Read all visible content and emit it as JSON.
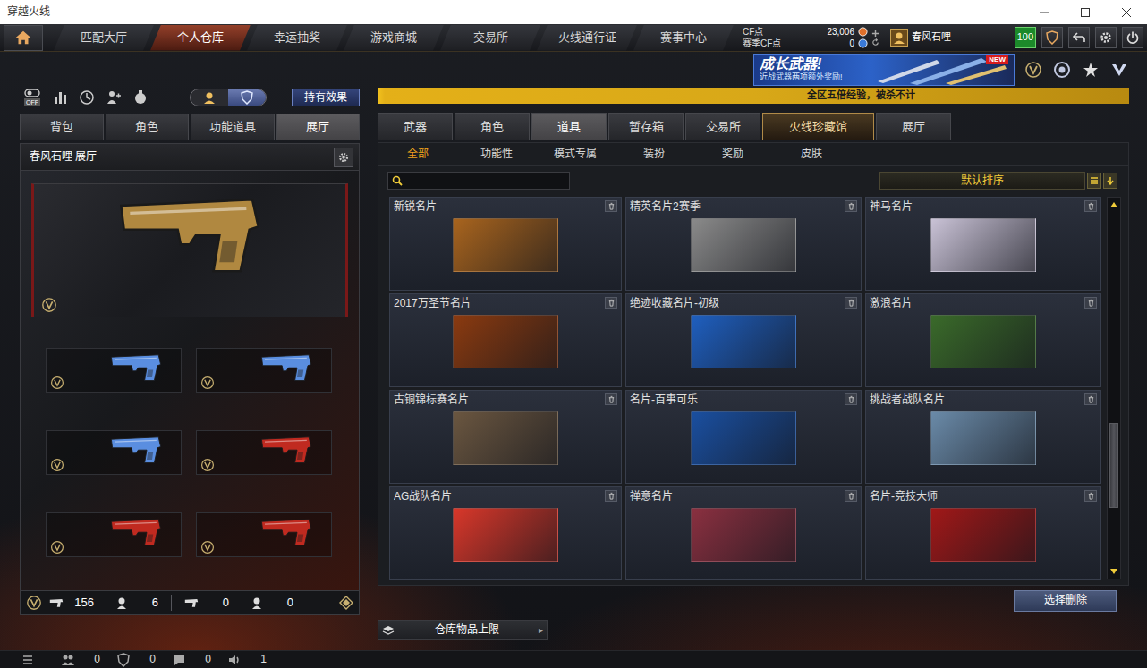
{
  "window": {
    "title": "穿越火线"
  },
  "nav": {
    "tabs": [
      {
        "label": "匹配大厅",
        "selected": false
      },
      {
        "label": "个人仓库",
        "selected": true
      },
      {
        "label": "幸运抽奖",
        "selected": false
      },
      {
        "label": "游戏商城",
        "selected": false
      },
      {
        "label": "交易所",
        "selected": false
      },
      {
        "label": "火线通行证",
        "selected": false
      },
      {
        "label": "赛事中心",
        "selected": false
      }
    ]
  },
  "currency": [
    {
      "label": "CF点",
      "value": "23,006",
      "color": "#e0702a"
    },
    {
      "label": "赛季CF点",
      "value": "0",
      "color": "#3a7ad8"
    }
  ],
  "user": {
    "name": "春风石哩",
    "level": "100"
  },
  "banner": {
    "title": "成长武器!",
    "subtitle": "近战武器两项额外奖励!",
    "badge": "NEW"
  },
  "marquee": "全区五倍经验，被杀不计",
  "left": {
    "off_label": "OFF",
    "toggle": [
      {
        "selected": false
      },
      {
        "selected": true
      }
    ],
    "effect_button": "持有效果",
    "tabs": [
      {
        "label": "背包",
        "selected": false
      },
      {
        "label": "角色",
        "selected": false
      },
      {
        "label": "功能道具",
        "selected": false
      },
      {
        "label": "展厅",
        "selected": true
      }
    ],
    "panel_title": "春风石哩 展厅",
    "featured": {
      "color": "#b08840"
    },
    "slots": [
      {
        "color": "#5a8ee0"
      },
      {
        "color": "#5a8ee0"
      },
      {
        "color": "#5a8ee0"
      },
      {
        "color": "#c02a20"
      },
      {
        "color": "#c02a20"
      },
      {
        "color": "#c02a20"
      }
    ],
    "stats": [
      "156",
      "6",
      "0",
      "0"
    ]
  },
  "right": {
    "tabs": [
      {
        "label": "武器",
        "selected": false,
        "kind": "normal"
      },
      {
        "label": "角色",
        "selected": false,
        "kind": "normal"
      },
      {
        "label": "道具",
        "selected": true,
        "kind": "normal"
      },
      {
        "label": "暂存箱",
        "selected": false,
        "kind": "normal"
      },
      {
        "label": "交易所",
        "selected": false,
        "kind": "normal"
      },
      {
        "label": "火线珍藏馆",
        "selected": false,
        "kind": "special"
      },
      {
        "label": "展厅",
        "selected": false,
        "kind": "normal"
      }
    ],
    "subtabs": [
      {
        "label": "全部",
        "selected": true
      },
      {
        "label": "功能性",
        "selected": false
      },
      {
        "label": "模式专属",
        "selected": false
      },
      {
        "label": "装扮",
        "selected": false
      },
      {
        "label": "奖励",
        "selected": false
      },
      {
        "label": "皮肤",
        "selected": false
      }
    ],
    "search": {
      "value": ""
    },
    "sort": "默认排序",
    "items": [
      {
        "name": "新锐名片",
        "color": "#a8641e"
      },
      {
        "name": "精英名片2赛季",
        "color": "#8a8a8a"
      },
      {
        "name": "神马名片",
        "color": "#c9c2d6"
      },
      {
        "name": "2017万圣节名片",
        "color": "#8a3a10"
      },
      {
        "name": "绝迹收藏名片-初级",
        "color": "#1f5fbf"
      },
      {
        "name": "激浪名片",
        "color": "#3a6a2a"
      },
      {
        "name": "古铜锦标赛名片",
        "color": "#6a5640"
      },
      {
        "name": "名片-百事可乐",
        "color": "#1a4fa0"
      },
      {
        "name": "挑战者战队名片",
        "color": "#6a8aa8"
      },
      {
        "name": "AG战队名片",
        "color": "#d8372a"
      },
      {
        "name": "禅意名片",
        "color": "#8a3040"
      },
      {
        "name": "名片-竞技大师",
        "color": "#a01818"
      }
    ],
    "scrollbar": {
      "level": 0.79
    },
    "delete_button": "选择删除",
    "capacity": {
      "label": "仓库物品上限",
      "arrow": "▸"
    }
  },
  "status_bar": [
    "0",
    "0",
    "0",
    "1"
  ]
}
